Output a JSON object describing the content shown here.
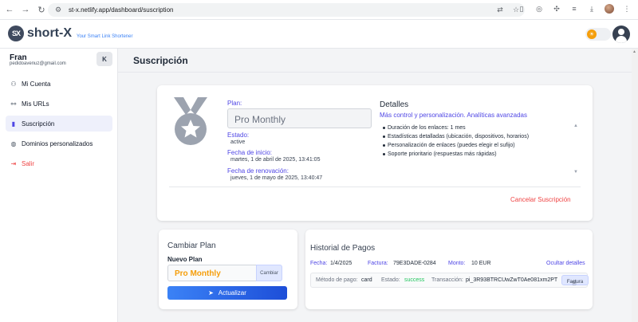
{
  "browser": {
    "url": "st-x.netlify.app/dashboard/suscription"
  },
  "header": {
    "logo_mark": "SX",
    "logo_text": "short-X",
    "tagline": "Your Smart Link Shortener"
  },
  "sidebar": {
    "user_name": "Fran",
    "user_email": "pedidoavenuz@gmail.com",
    "collapse_label": "K",
    "items": [
      {
        "label": "Mi Cuenta",
        "icon": "user-icon"
      },
      {
        "label": "Mis URLs",
        "icon": "link-icon"
      },
      {
        "label": "Suscripción",
        "icon": "bookmark-icon",
        "active": true
      },
      {
        "label": "Dominios personalizados",
        "icon": "globe-icon"
      },
      {
        "label": "Salir",
        "icon": "logout-icon"
      }
    ]
  },
  "main": {
    "title": "Suscripción",
    "subscription": {
      "plan_label": "Plan:",
      "plan_value": "Pro Monthly",
      "estado_label": "Estado:",
      "estado_value": "active",
      "inicio_label": "Fecha de inicio:",
      "inicio_value": "martes, 1 de abril de 2025, 13:41:05",
      "renov_label": "Fecha de renovación:",
      "renov_value": "jueves, 1 de mayo de 2025, 13:40:47",
      "details_title": "Detalles",
      "details_subtitle": "Más control y personalización. Analíticas avanzadas",
      "features": [
        "Duración de los enlaces: 1 mes",
        "Estadísticas detalladas (ubicación, dispositivos, horarios)",
        "Personalización de enlaces (puedes elegir el sufijo)",
        "Soporte prioritario (respuestas más rápidas)"
      ],
      "cancel_label": "Cancelar Suscripción"
    },
    "change_plan": {
      "title": "Cambiar Plan",
      "new_plan_label": "Nuevo Plan",
      "selected_plan": "Pro Monthly",
      "change_button": "Cambiar",
      "update_button": "Actualizar"
    },
    "payment_history": {
      "title": "Historial de Pagos",
      "fecha_label": "Fecha:",
      "fecha_value": "1/4/2025",
      "factura_label": "Factura:",
      "factura_value": "79E3DADE-0284",
      "monto_label": "Monto:",
      "monto_value": "10 EUR",
      "hide_details": "Ocultar detalles",
      "metodo_label": "Método de pago:",
      "metodo_value": "card",
      "estado_label": "Estado:",
      "estado_value": "success",
      "transaccion_label": "Transacción:",
      "transaccion_value": "pi_3R93BTRCUwZwT0Ae081xm2PT",
      "invoice_button": "Factura"
    }
  },
  "colors": {
    "accent": "#4f46e5",
    "danger": "#ef4444",
    "plan_highlight": "#f59e0b",
    "success": "#22c55e",
    "button_blue": "#2563eb"
  }
}
